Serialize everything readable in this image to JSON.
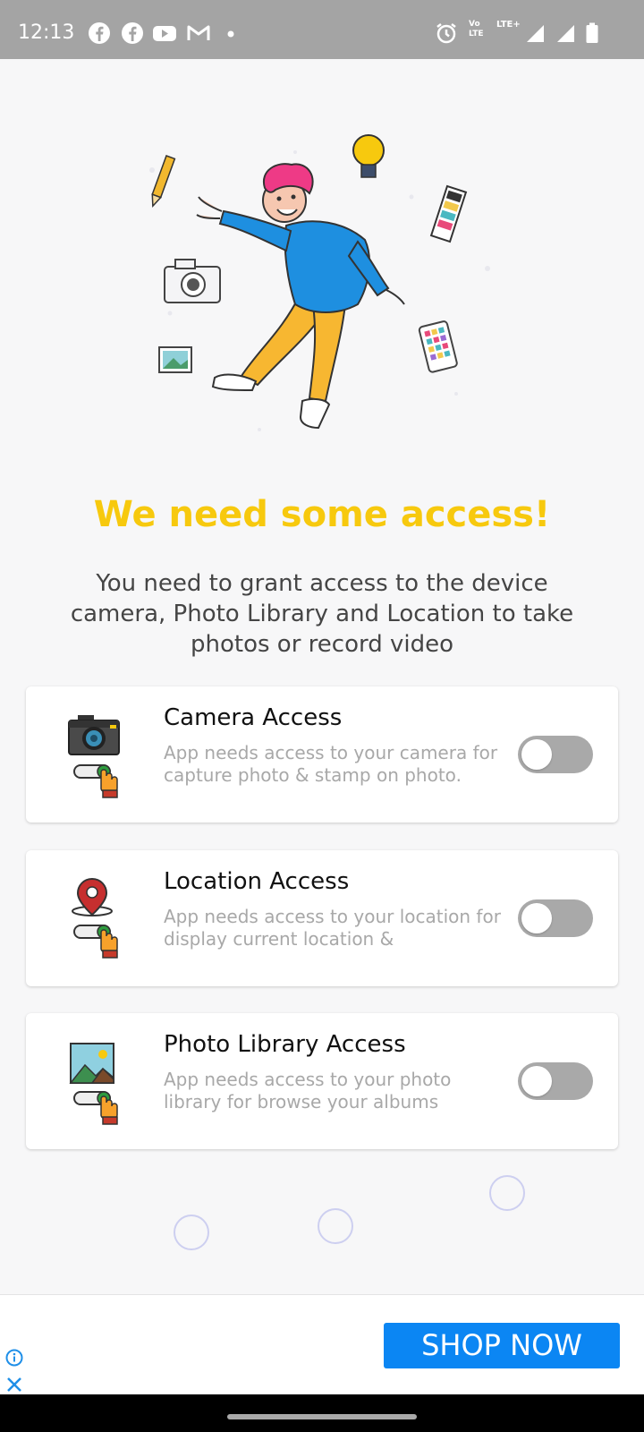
{
  "status_bar": {
    "time": "12:13",
    "left_icons": [
      "facebook-icon",
      "facebook-icon",
      "youtube-icon",
      "gmail-icon",
      "dot-icon"
    ],
    "right_icons": [
      "alarm-icon",
      "volte-icon",
      "lte-signal-icon",
      "signal-icon",
      "battery-icon"
    ],
    "network_label": "LTE+",
    "volte_label": "Vo",
    "lte_label": "LTE"
  },
  "main": {
    "headline": "We need some access!",
    "description": "You need to grant access to the device camera, Photo Library and Location to take photos or record video"
  },
  "permissions": [
    {
      "title": "Camera Access",
      "description": "App needs access to your camera for capture photo & stamp on photo.",
      "icon": "camera-icon",
      "enabled": false
    },
    {
      "title": "Location Access",
      "description": "App needs access to your location for display current location &",
      "icon": "location-pin-icon",
      "enabled": false
    },
    {
      "title": "Photo Library Access",
      "description": "App needs access to your photo library for browse your albums",
      "icon": "photo-library-icon",
      "enabled": false
    }
  ],
  "ad": {
    "button_label": "SHOP NOW"
  },
  "colors": {
    "headline": "#f7c90e",
    "toggle_off": "#a9a9a9",
    "ad_button": "#0b86f3",
    "status_bar": "#a4a4a4"
  }
}
